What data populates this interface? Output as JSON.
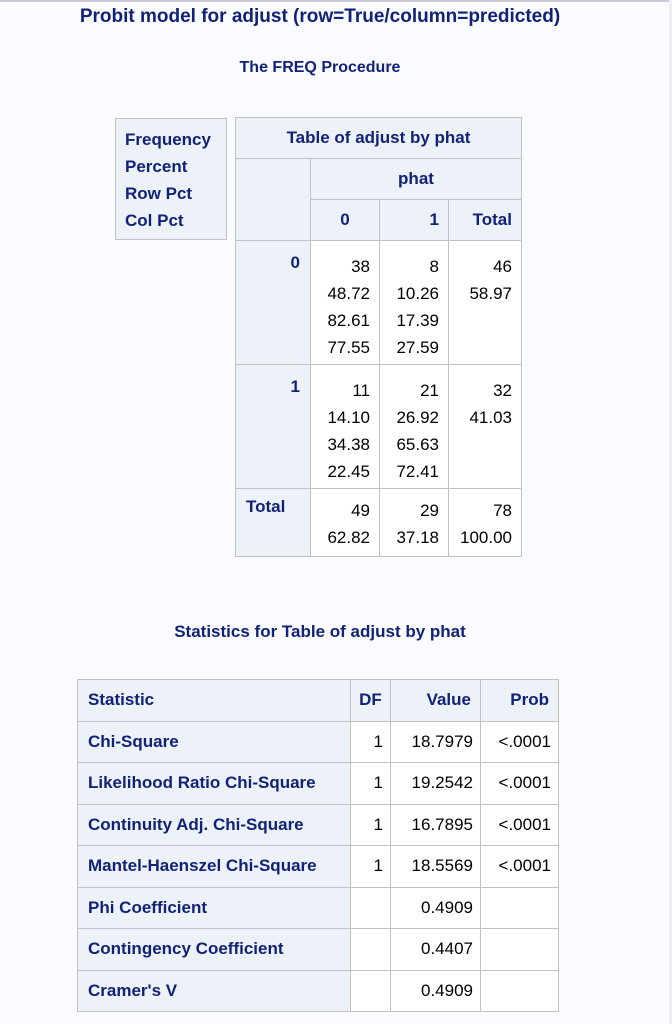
{
  "title": "Probit model for adjust (row=True/column=predicted)",
  "procedure": "The FREQ Procedure",
  "legend": [
    "Frequency",
    "Percent",
    "Row Pct",
    "Col Pct"
  ],
  "crosstab": {
    "title": "Table of adjust by phat",
    "col_var": "phat",
    "row_var": "adjust",
    "col_headers": [
      "0",
      "1",
      "Total"
    ],
    "rows": [
      {
        "label": "0",
        "cells": [
          [
            "38",
            "48.72",
            "82.61",
            "77.55"
          ],
          [
            "8",
            "10.26",
            "17.39",
            "27.59"
          ],
          [
            "46",
            "58.97"
          ]
        ]
      },
      {
        "label": "1",
        "cells": [
          [
            "11",
            "14.10",
            "34.38",
            "22.45"
          ],
          [
            "21",
            "26.92",
            "65.63",
            "72.41"
          ],
          [
            "32",
            "41.03"
          ]
        ]
      },
      {
        "label": "Total",
        "cells": [
          [
            "49",
            "62.82"
          ],
          [
            "29",
            "37.18"
          ],
          [
            "78",
            "100.00"
          ]
        ]
      }
    ]
  },
  "stats": {
    "title": "Statistics for Table of adjust by phat",
    "headers": [
      "Statistic",
      "DF",
      "Value",
      "Prob"
    ],
    "rows": [
      {
        "statistic": "Chi-Square",
        "df": "1",
        "value": "18.7979",
        "prob": "<.0001"
      },
      {
        "statistic": "Likelihood Ratio Chi-Square",
        "df": "1",
        "value": "19.2542",
        "prob": "<.0001"
      },
      {
        "statistic": "Continuity Adj. Chi-Square",
        "df": "1",
        "value": "16.7895",
        "prob": "<.0001"
      },
      {
        "statistic": "Mantel-Haenszel Chi-Square",
        "df": "1",
        "value": "18.5569",
        "prob": "<.0001"
      },
      {
        "statistic": "Phi Coefficient",
        "df": "",
        "value": "0.4909",
        "prob": ""
      },
      {
        "statistic": "Contingency Coefficient",
        "df": "",
        "value": "0.4407",
        "prob": ""
      },
      {
        "statistic": "Cramer's V",
        "df": "",
        "value": "0.4909",
        "prob": ""
      }
    ]
  }
}
